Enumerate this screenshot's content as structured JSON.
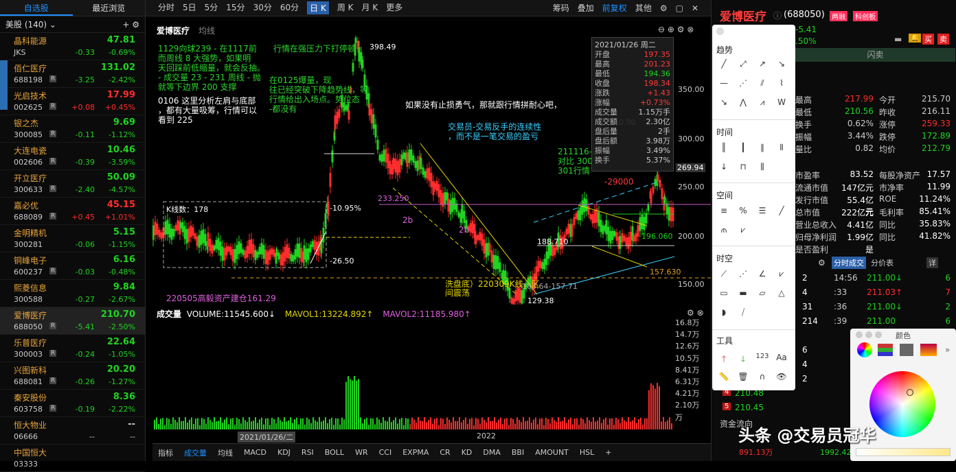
{
  "watchlist": {
    "tabs": [
      "自选股",
      "最近浏览"
    ],
    "group": "美股 (140)",
    "items": [
      {
        "name": "晶科能源",
        "code": "JKS",
        "price": "47.81",
        "chg": "-0.33",
        "pct": "-0.69%",
        "dir": "dn",
        "r": false
      },
      {
        "name": "佰仁医疗",
        "code": "688198",
        "price": "131.02",
        "chg": "-3.25",
        "pct": "-2.42%",
        "dir": "dn",
        "r": true
      },
      {
        "name": "光启技术",
        "code": "002625",
        "price": "17.99",
        "chg": "+0.08",
        "pct": "+0.45%",
        "dir": "up",
        "r": true
      },
      {
        "name": "银之杰",
        "code": "300085",
        "price": "9.69",
        "chg": "-0.11",
        "pct": "-1.12%",
        "dir": "dn",
        "r": true
      },
      {
        "name": "大连电瓷",
        "code": "002606",
        "price": "10.46",
        "chg": "-0.39",
        "pct": "-3.59%",
        "dir": "dn",
        "r": true
      },
      {
        "name": "开立医疗",
        "code": "300633",
        "price": "50.09",
        "chg": "-2.40",
        "pct": "-4.57%",
        "dir": "dn",
        "r": true
      },
      {
        "name": "嘉必优",
        "code": "688089",
        "price": "45.15",
        "chg": "+0.45",
        "pct": "+1.01%",
        "dir": "up",
        "r": true
      },
      {
        "name": "金明精机",
        "code": "300281",
        "price": "5.15",
        "chg": "-0.06",
        "pct": "-1.15%",
        "dir": "dn",
        "r": false
      },
      {
        "name": "铜峰电子",
        "code": "600237",
        "price": "6.16",
        "chg": "-0.03",
        "pct": "-0.48%",
        "dir": "dn",
        "r": true
      },
      {
        "name": "熙菱信息",
        "code": "300588",
        "price": "9.84",
        "chg": "-0.27",
        "pct": "-2.67%",
        "dir": "dn",
        "r": false
      },
      {
        "name": "爱博医疗",
        "code": "688050",
        "price": "210.70",
        "chg": "-5.41",
        "pct": "-2.50%",
        "dir": "dn",
        "r": true,
        "sel": true
      },
      {
        "name": "乐普医疗",
        "code": "300003",
        "price": "22.64",
        "chg": "-0.24",
        "pct": "-1.05%",
        "dir": "dn",
        "r": true
      },
      {
        "name": "兴图新科",
        "code": "688081",
        "price": "20.20",
        "chg": "-0.26",
        "pct": "-1.27%",
        "dir": "dn",
        "r": true
      },
      {
        "name": "秦安股份",
        "code": "603758",
        "price": "8.36",
        "chg": "-0.19",
        "pct": "-2.22%",
        "dir": "dn",
        "r": true
      },
      {
        "name": "恒大物业",
        "code": "06666",
        "price": "--",
        "chg": "--",
        "pct": "--",
        "dir": "flat",
        "r": false
      },
      {
        "name": "中国恒大",
        "code": "03333",
        "price": "",
        "chg": "",
        "pct": "",
        "dir": "flat",
        "r": false
      }
    ]
  },
  "toolbar": {
    "periods": [
      "分时",
      "5日",
      "5分",
      "15分",
      "30分",
      "60分",
      "日 K",
      "周 K",
      "月 K",
      "更多"
    ],
    "active": "日 K",
    "right": [
      "筹码",
      "叠加",
      "前复权",
      "其他"
    ]
  },
  "chart": {
    "stock": "爱博医疗",
    "ma_label": "均线",
    "prices": [
      "350.00",
      "300.00",
      "269.94",
      "250.00",
      "200.00",
      "150.00"
    ],
    "notes": {
      "n1": "1129向球239 - 在1117前",
      "n2": "而周线 8 大强势，如果明",
      "n3": "天回踩前低缩量，就会反抽。",
      "n4": "- 成交量 23 - 231 周线 - 抛",
      "n5": "就等下边界 200 支撑",
      "n6": "0106 这里分析左肩与底部",
      "n7": "，都有大量吸筹，行情可以",
      "n8": "看到 225",
      "n9": "行情在强压力下打停顿",
      "n10": "在0125爆量，现",
      "n11": "往已经突破下降趋势线，等",
      "n12": "行情给出入场点。势位态",
      "n13": "-都没有",
      "big1": "如果没有止损勇气，那就跟行情拼耐心吧，",
      "big2": "交易员-交易反手的连续性",
      "big3": "，而不是一笔交易的盈亏",
      "k_count": "K线数：178",
      "pct1": "-10.95%",
      "pct2": "-26.50",
      "high": "398.49",
      "low": "129.38",
      "lvl1": "233.250",
      "lvl2": "188.710",
      "lvl3": "196.060",
      "lvl4": "157.630",
      "lvl5": "-29000",
      "range": "163.64-157.71",
      "wash": "洗盘底）220309K线，区",
      "wash2": "间震荡",
      "b1": "2b",
      "b2": "2b",
      "base": "220505高毅资产建仓161.29",
      "r1": "211116-2",
      "r2": "对比 300",
      "r3": "301行情"
    },
    "info": {
      "date": "2021/01/26 周二",
      "rows": [
        [
          "开盘",
          "197.35"
        ],
        [
          "最高",
          "201.23"
        ],
        [
          "最低",
          "194.36"
        ],
        [
          "收盘",
          "198.34"
        ],
        [
          "涨跌",
          "+1.43"
        ],
        [
          "涨幅",
          "+0.73%"
        ],
        [
          "成交量",
          "1.15万手"
        ],
        [
          "成交额",
          "2.30亿"
        ],
        [
          "盘后量",
          "2手"
        ],
        [
          "盘后额",
          "3.98万"
        ],
        [
          "振幅",
          "3.49%"
        ],
        [
          "换手",
          "5.37%"
        ]
      ]
    }
  },
  "volume": {
    "title": "成交量",
    "vol": "VOLUME:11545.600↓",
    "mavol1": "MAVOL1:13224.892↑",
    "mavol2": "MAVOL2:11185.980↑",
    "axis": [
      "16.8万",
      "14.7万",
      "12.6万",
      "10.5万",
      "8.41万",
      "6.31万",
      "4.21万",
      "2.10万",
      "万"
    ],
    "date_left": "2021/01/26/二",
    "date_mid": "2022"
  },
  "bottom_tabs": [
    "指标",
    "成交量",
    "均线",
    "MACD",
    "KDJ",
    "RSI",
    "BOLL",
    "WR",
    "CCI",
    "EXPMA",
    "CR",
    "KD",
    "DMA",
    "BBI",
    "AMOUNT",
    "HSL"
  ],
  "right": {
    "name": "爱博医疗",
    "code": "(688050)",
    "tags": [
      "两融",
      "科创板"
    ],
    "chg": "-5.41",
    "pct": ".50%",
    "btns": [
      "买",
      "卖"
    ],
    "flash": "闪卖",
    "stats": [
      [
        "最高",
        "217.99",
        "今开",
        "215.70"
      ],
      [
        "最低",
        "210.56",
        "昨收",
        "216.11"
      ],
      [
        "换手",
        "0.62%",
        "涨停",
        "259.33"
      ],
      [
        "振幅",
        "3.44%",
        "跌停",
        "172.89"
      ],
      [
        "量比",
        "0.82",
        "均价",
        "212.79"
      ]
    ],
    "fund": [
      [
        "市盈率",
        "83.52",
        "每股净资产",
        "17.57"
      ],
      [
        "流通市值",
        "147亿元",
        "市净率",
        "11.99"
      ],
      [
        "发行市值",
        "55.4亿元",
        "ROE",
        "11.24%"
      ],
      [
        "总市值",
        "222亿元",
        "毛利率",
        "85.41%"
      ],
      [
        "营业总收入",
        "4.41亿",
        "同比",
        "35.83%"
      ],
      [
        "归母净利润",
        "1.99亿",
        "同比",
        "41.82%"
      ],
      [
        "是否盈利",
        "是",
        "",
        ""
      ]
    ],
    "tabs": [
      "分时成交",
      "分价表",
      "详"
    ],
    "trades": [
      [
        "14:56",
        "211.00↓",
        "6"
      ],
      [
        ":33",
        "211.03↑",
        "7"
      ],
      [
        ":36",
        "211.00↓",
        "2"
      ],
      [
        ":39",
        "211.00",
        "6"
      ]
    ],
    "bids": [
      "2",
      "4",
      "31",
      "214",
      "6",
      "4",
      "2"
    ],
    "bid_rows": [
      [
        "4",
        "210.48"
      ],
      [
        "5",
        "210.45"
      ]
    ],
    "fund_flow": "资金流向",
    "ff1": "891.13万",
    "ff2": "1992.42万"
  },
  "draw_panel": {
    "sections": [
      "趋势",
      "时间",
      "空间",
      "时空",
      "工具"
    ]
  },
  "color_panel": {
    "title": "颜色"
  },
  "watermark": "头条 @交易员冠华"
}
